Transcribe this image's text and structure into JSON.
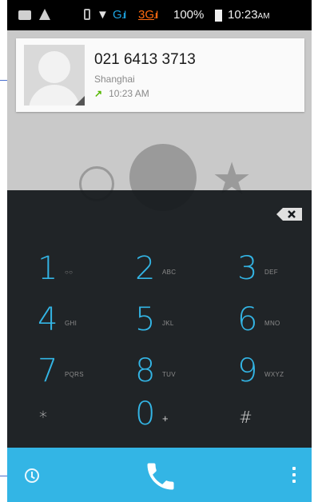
{
  "status_bar": {
    "network_g": "G",
    "network_3g": "3G",
    "battery_percent": "100%",
    "time": "10:23",
    "time_suffix": "AM"
  },
  "contact_card": {
    "phone_number": "021 6413 3713",
    "location": "Shanghai",
    "call_time": "10:23 AM",
    "call_type_icon": "outgoing-call-arrow-icon"
  },
  "dialpad": {
    "keys": [
      {
        "digit": "1",
        "letters": "QO"
      },
      {
        "digit": "2",
        "letters": "ABC"
      },
      {
        "digit": "3",
        "letters": "DEF"
      },
      {
        "digit": "4",
        "letters": "GHI"
      },
      {
        "digit": "5",
        "letters": "JKL"
      },
      {
        "digit": "6",
        "letters": "MNO"
      },
      {
        "digit": "7",
        "letters": "PQRS"
      },
      {
        "digit": "8",
        "letters": "TUV"
      },
      {
        "digit": "9",
        "letters": "WXYZ"
      },
      {
        "digit": "*",
        "letters": ""
      },
      {
        "digit": "0",
        "letters": "+"
      },
      {
        "digit": "#",
        "letters": ""
      }
    ]
  },
  "colors": {
    "accent": "#33b5e5",
    "dialpad_bg": "#161a1e",
    "outgoing_arrow": "#55b800"
  }
}
